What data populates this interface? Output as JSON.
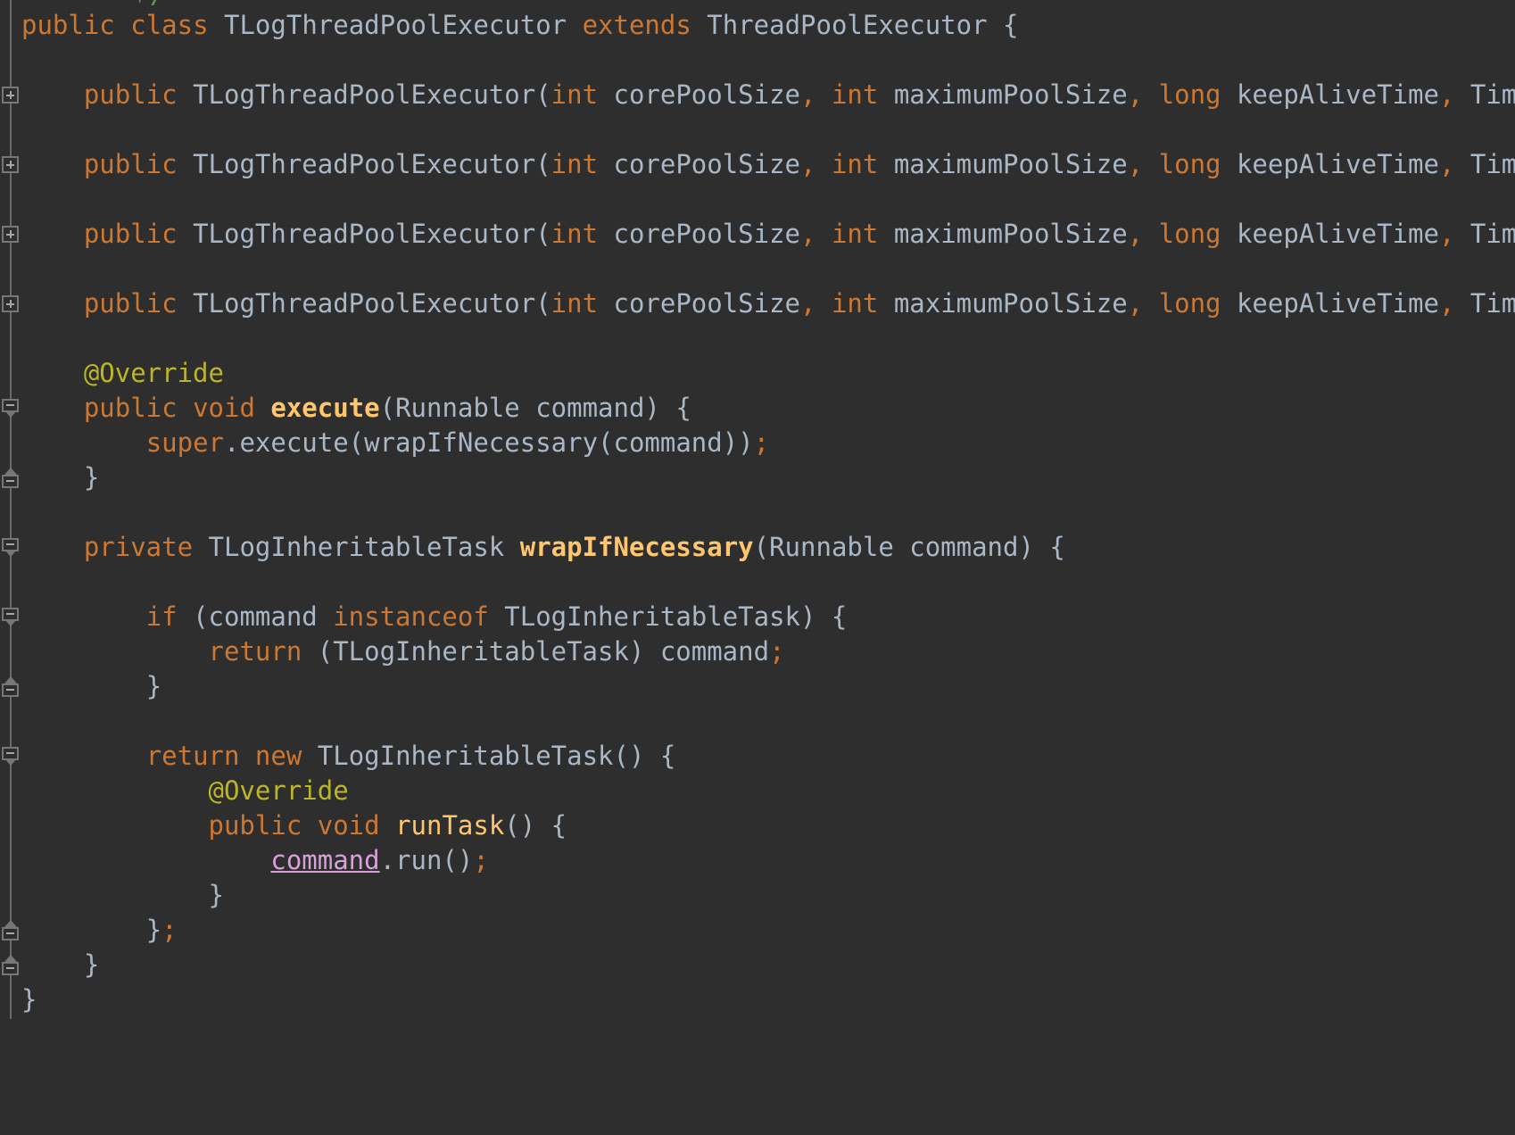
{
  "editor": {
    "theme_name": "darcula",
    "language": "java",
    "background_color": "#2e2e2e",
    "gutter_color": "#2e2e2e",
    "default_text_color": "#a9b7c6",
    "keyword_color": "#cc7832",
    "method_color": "#ffc66d",
    "annotation_color": "#bbb529",
    "comment_color": "#629755",
    "captured_variable_color": "#d9a0d9",
    "fold_marker_color": "#777777",
    "top_clipped_comment": "*/",
    "lines": [
      {
        "indent": 0,
        "fold": "none",
        "tokens": [
          {
            "text": "public",
            "style": "kw"
          },
          {
            "text": " ",
            "style": "id"
          },
          {
            "text": "class",
            "style": "kw"
          },
          {
            "text": " ",
            "style": "id"
          },
          {
            "text": "TLogThreadPoolExecutor",
            "style": "type"
          },
          {
            "text": " ",
            "style": "id"
          },
          {
            "text": "extends",
            "style": "kw"
          },
          {
            "text": " ",
            "style": "id"
          },
          {
            "text": "ThreadPoolExecutor",
            "style": "type"
          },
          {
            "text": " {",
            "style": "id"
          }
        ]
      },
      {
        "indent": 0,
        "fold": "none",
        "tokens": []
      },
      {
        "indent": 1,
        "fold": "plus",
        "tokens": [
          {
            "text": "public",
            "style": "kw"
          },
          {
            "text": " ",
            "style": "id"
          },
          {
            "text": "TLogThreadPoolExecutor",
            "style": "type"
          },
          {
            "text": "(",
            "style": "id"
          },
          {
            "text": "int",
            "style": "kw"
          },
          {
            "text": " corePoolSize",
            "style": "id"
          },
          {
            "text": ",",
            "style": "punct-kw"
          },
          {
            "text": " ",
            "style": "id"
          },
          {
            "text": "int",
            "style": "kw"
          },
          {
            "text": " maximumPoolSize",
            "style": "id"
          },
          {
            "text": ",",
            "style": "punct-kw"
          },
          {
            "text": " ",
            "style": "id"
          },
          {
            "text": "long",
            "style": "kw"
          },
          {
            "text": " keepAliveTime",
            "style": "id"
          },
          {
            "text": ",",
            "style": "punct-kw"
          },
          {
            "text": " TimeUnit uni",
            "style": "id"
          }
        ]
      },
      {
        "indent": 0,
        "fold": "none",
        "tokens": []
      },
      {
        "indent": 1,
        "fold": "plus",
        "tokens": [
          {
            "text": "public",
            "style": "kw"
          },
          {
            "text": " ",
            "style": "id"
          },
          {
            "text": "TLogThreadPoolExecutor",
            "style": "type"
          },
          {
            "text": "(",
            "style": "id"
          },
          {
            "text": "int",
            "style": "kw"
          },
          {
            "text": " corePoolSize",
            "style": "id"
          },
          {
            "text": ",",
            "style": "punct-kw"
          },
          {
            "text": " ",
            "style": "id"
          },
          {
            "text": "int",
            "style": "kw"
          },
          {
            "text": " maximumPoolSize",
            "style": "id"
          },
          {
            "text": ",",
            "style": "punct-kw"
          },
          {
            "text": " ",
            "style": "id"
          },
          {
            "text": "long",
            "style": "kw"
          },
          {
            "text": " keepAliveTime",
            "style": "id"
          },
          {
            "text": ",",
            "style": "punct-kw"
          },
          {
            "text": " TimeUnit uni",
            "style": "id"
          }
        ]
      },
      {
        "indent": 0,
        "fold": "none",
        "tokens": []
      },
      {
        "indent": 1,
        "fold": "plus",
        "tokens": [
          {
            "text": "public",
            "style": "kw"
          },
          {
            "text": " ",
            "style": "id"
          },
          {
            "text": "TLogThreadPoolExecutor",
            "style": "type"
          },
          {
            "text": "(",
            "style": "id"
          },
          {
            "text": "int",
            "style": "kw"
          },
          {
            "text": " corePoolSize",
            "style": "id"
          },
          {
            "text": ",",
            "style": "punct-kw"
          },
          {
            "text": " ",
            "style": "id"
          },
          {
            "text": "int",
            "style": "kw"
          },
          {
            "text": " maximumPoolSize",
            "style": "id"
          },
          {
            "text": ",",
            "style": "punct-kw"
          },
          {
            "text": " ",
            "style": "id"
          },
          {
            "text": "long",
            "style": "kw"
          },
          {
            "text": " keepAliveTime",
            "style": "id"
          },
          {
            "text": ",",
            "style": "punct-kw"
          },
          {
            "text": " TimeUnit uni",
            "style": "id"
          }
        ]
      },
      {
        "indent": 0,
        "fold": "none",
        "tokens": []
      },
      {
        "indent": 1,
        "fold": "plus",
        "tokens": [
          {
            "text": "public",
            "style": "kw"
          },
          {
            "text": " ",
            "style": "id"
          },
          {
            "text": "TLogThreadPoolExecutor",
            "style": "type"
          },
          {
            "text": "(",
            "style": "id"
          },
          {
            "text": "int",
            "style": "kw"
          },
          {
            "text": " corePoolSize",
            "style": "id"
          },
          {
            "text": ",",
            "style": "punct-kw"
          },
          {
            "text": " ",
            "style": "id"
          },
          {
            "text": "int",
            "style": "kw"
          },
          {
            "text": " maximumPoolSize",
            "style": "id"
          },
          {
            "text": ",",
            "style": "punct-kw"
          },
          {
            "text": " ",
            "style": "id"
          },
          {
            "text": "long",
            "style": "kw"
          },
          {
            "text": " keepAliveTime",
            "style": "id"
          },
          {
            "text": ",",
            "style": "punct-kw"
          },
          {
            "text": " TimeUnit uni",
            "style": "id"
          }
        ]
      },
      {
        "indent": 0,
        "fold": "none",
        "tokens": []
      },
      {
        "indent": 1,
        "fold": "none",
        "tokens": [
          {
            "text": "@Override",
            "style": "anno"
          }
        ]
      },
      {
        "indent": 1,
        "fold": "minus-down",
        "tokens": [
          {
            "text": "public",
            "style": "kw"
          },
          {
            "text": " ",
            "style": "id"
          },
          {
            "text": "void",
            "style": "kw"
          },
          {
            "text": " ",
            "style": "id"
          },
          {
            "text": "execute",
            "style": "method-b"
          },
          {
            "text": "(Runnable command) {",
            "style": "id"
          }
        ]
      },
      {
        "indent": 2,
        "fold": "none",
        "tokens": [
          {
            "text": "super",
            "style": "kw"
          },
          {
            "text": ".execute(wrapIfNecessary(command))",
            "style": "id"
          },
          {
            "text": ";",
            "style": "punct-kw"
          }
        ]
      },
      {
        "indent": 1,
        "fold": "minus-up",
        "tokens": [
          {
            "text": "}",
            "style": "id"
          }
        ]
      },
      {
        "indent": 0,
        "fold": "none",
        "tokens": []
      },
      {
        "indent": 1,
        "fold": "minus-down",
        "tokens": [
          {
            "text": "private",
            "style": "kw"
          },
          {
            "text": " ",
            "style": "id"
          },
          {
            "text": "TLogInheritableTask",
            "style": "type"
          },
          {
            "text": " ",
            "style": "id"
          },
          {
            "text": "wrapIfNecessary",
            "style": "method-b"
          },
          {
            "text": "(Runnable command) {",
            "style": "id"
          }
        ]
      },
      {
        "indent": 0,
        "fold": "none",
        "tokens": []
      },
      {
        "indent": 2,
        "fold": "minus-down",
        "tokens": [
          {
            "text": "if",
            "style": "kw"
          },
          {
            "text": " (command ",
            "style": "id"
          },
          {
            "text": "instanceof",
            "style": "kw"
          },
          {
            "text": " TLogInheritableTask) {",
            "style": "id"
          }
        ]
      },
      {
        "indent": 3,
        "fold": "none",
        "tokens": [
          {
            "text": "return",
            "style": "kw"
          },
          {
            "text": " (TLogInheritableTask) command",
            "style": "id"
          },
          {
            "text": ";",
            "style": "punct-kw"
          }
        ]
      },
      {
        "indent": 2,
        "fold": "minus-up",
        "tokens": [
          {
            "text": "}",
            "style": "id"
          }
        ]
      },
      {
        "indent": 0,
        "fold": "none",
        "tokens": []
      },
      {
        "indent": 2,
        "fold": "minus-down",
        "tokens": [
          {
            "text": "return",
            "style": "kw"
          },
          {
            "text": " ",
            "style": "id"
          },
          {
            "text": "new",
            "style": "kw"
          },
          {
            "text": " TLogInheritableTask() {",
            "style": "id"
          }
        ]
      },
      {
        "indent": 3,
        "fold": "none",
        "tokens": [
          {
            "text": "@Override",
            "style": "anno"
          }
        ]
      },
      {
        "indent": 3,
        "fold": "none",
        "tokens": [
          {
            "text": "public",
            "style": "kw"
          },
          {
            "text": " ",
            "style": "id"
          },
          {
            "text": "void",
            "style": "kw"
          },
          {
            "text": " ",
            "style": "id"
          },
          {
            "text": "runTask",
            "style": "method"
          },
          {
            "text": "() {",
            "style": "id"
          }
        ]
      },
      {
        "indent": 4,
        "fold": "none",
        "tokens": [
          {
            "text": "command",
            "style": "captured"
          },
          {
            "text": ".run()",
            "style": "id"
          },
          {
            "text": ";",
            "style": "punct-kw"
          }
        ]
      },
      {
        "indent": 3,
        "fold": "none",
        "tokens": [
          {
            "text": "}",
            "style": "id"
          }
        ]
      },
      {
        "indent": 2,
        "fold": "minus-up",
        "tokens": [
          {
            "text": "}",
            "style": "id"
          },
          {
            "text": ";",
            "style": "punct-kw"
          }
        ]
      },
      {
        "indent": 1,
        "fold": "minus-up",
        "tokens": [
          {
            "text": "}",
            "style": "id"
          }
        ]
      },
      {
        "indent": 0,
        "fold": "none",
        "tokens": [
          {
            "text": "}",
            "style": "id"
          }
        ]
      }
    ]
  }
}
